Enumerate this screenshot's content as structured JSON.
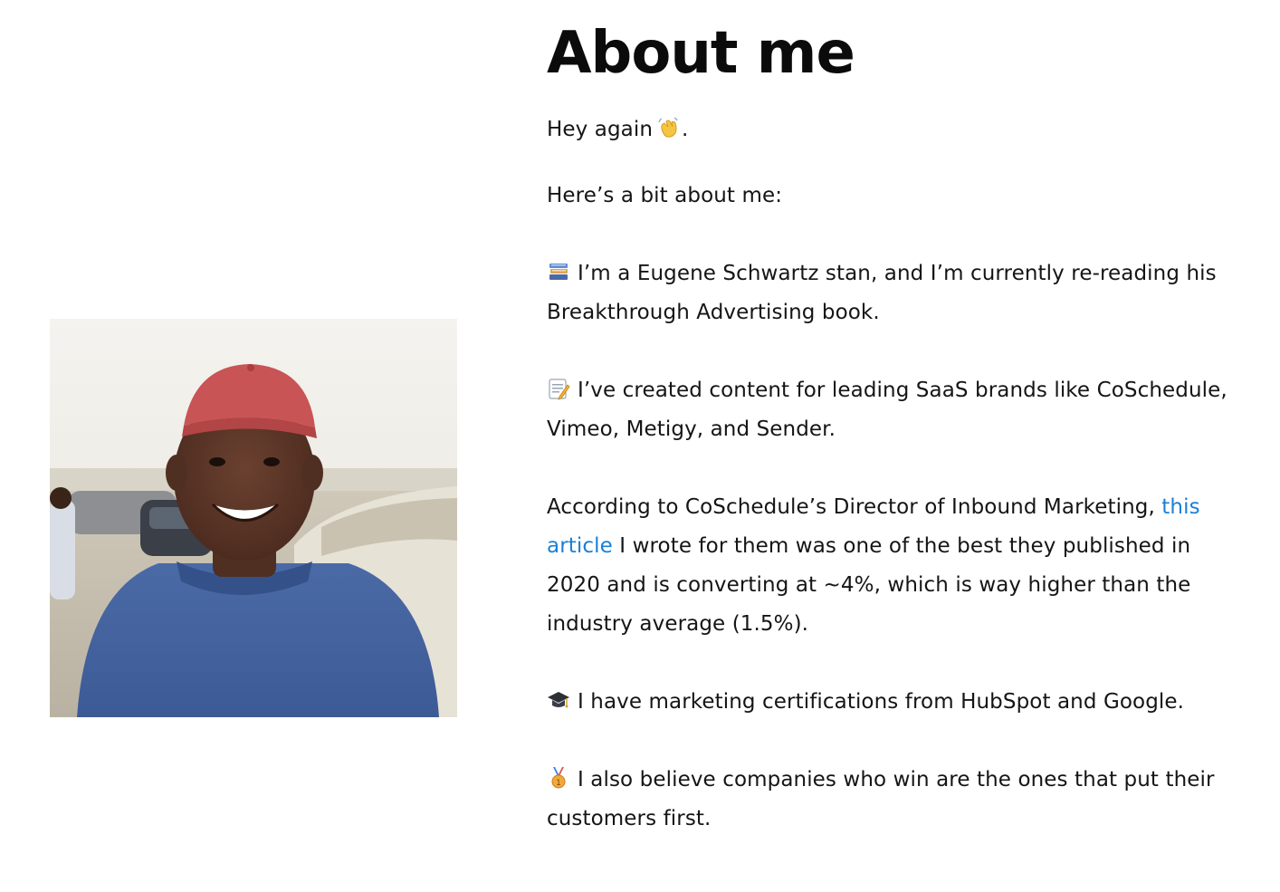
{
  "page": {
    "title": "About me",
    "greeting": "Hey again",
    "greeting_end": ".",
    "intro": "Here’s a bit about me:"
  },
  "items": [
    {
      "icon": "books-icon",
      "text": "I’m a Eugene Schwartz stan, and I’m currently re-reading his Breakthrough Advertising book."
    },
    {
      "icon": "memo-icon",
      "text": "I’ve created content for leading SaaS brands like CoSchedule, Vimeo, Metigy, and Sender."
    },
    {
      "text_before": "According to CoSchedule’s Director of Inbound Marketing,",
      "link_text": "this article",
      "text_after": "I wrote for them was one of the best they published in 2020 and is converting at ~4%, which is way higher than the industry average (1.5%)."
    },
    {
      "icon": "graduation-cap-icon",
      "text": "I have marketing certifications from HubSpot and Google."
    },
    {
      "icon": "medal-icon",
      "text": "I also believe companies who win are the ones that put their customers first."
    }
  ],
  "colors": {
    "text": "#151515",
    "link": "#1a7fd6",
    "background": "#ffffff"
  },
  "icons": {
    "greeting": "waving-hand-icon",
    "photo": "profile-photo"
  }
}
